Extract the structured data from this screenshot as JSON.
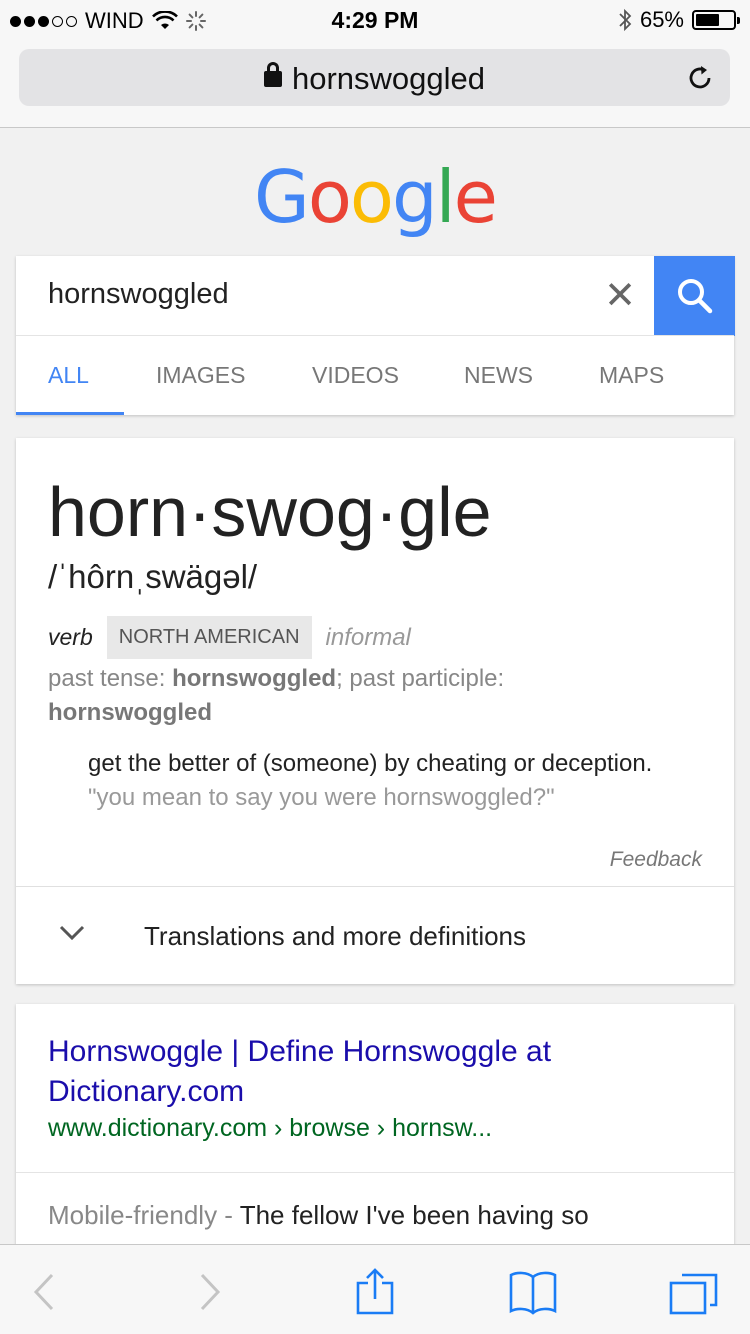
{
  "status_bar": {
    "carrier": "WIND",
    "time": "4:29 PM",
    "battery": "65%",
    "battery_level": 0.65,
    "signal_bars_filled": 3,
    "signal_bars_total": 5
  },
  "browser": {
    "url": "hornswoggled",
    "icons": {
      "lock": "lock-icon",
      "reload": "reload-icon"
    }
  },
  "logo": {
    "letters": [
      "G",
      "o",
      "o",
      "g",
      "l",
      "e"
    ]
  },
  "search": {
    "query": "hornswoggled",
    "clear_symbol": "✕",
    "tabs": [
      "ALL",
      "IMAGES",
      "VIDEOS",
      "NEWS",
      "MAPS"
    ],
    "active_tab": "ALL",
    "accent": "#4285f4"
  },
  "definition": {
    "headword": "horn·swog·gle",
    "phonetic": "/ˈhôrnˌswägəl/",
    "part_of_speech": "verb",
    "region": "NORTH AMERICAN",
    "register": "informal",
    "past_tense_label": "past tense: ",
    "past_tense": "hornswoggled",
    "past_participle_label": "; past participle: ",
    "past_participle": "hornswoggled",
    "meaning": "get the better of (someone) by cheating or deception.",
    "example": "\"you mean to say you were hornswoggled?\"",
    "feedback": "Feedback",
    "more_label": "Translations and more definitions"
  },
  "result": {
    "title": "Hornswoggle | Define Hornswoggle at Dictionary.com",
    "url": "www.dictionary.com › browse › hornsw...",
    "mobile_friendly": "Mobile-friendly - ",
    "snippet": "The fellow I've been having so"
  },
  "toolbar": {
    "icons": [
      "back-icon",
      "forward-icon",
      "share-icon",
      "bookmarks-icon",
      "tabs-icon"
    ]
  }
}
